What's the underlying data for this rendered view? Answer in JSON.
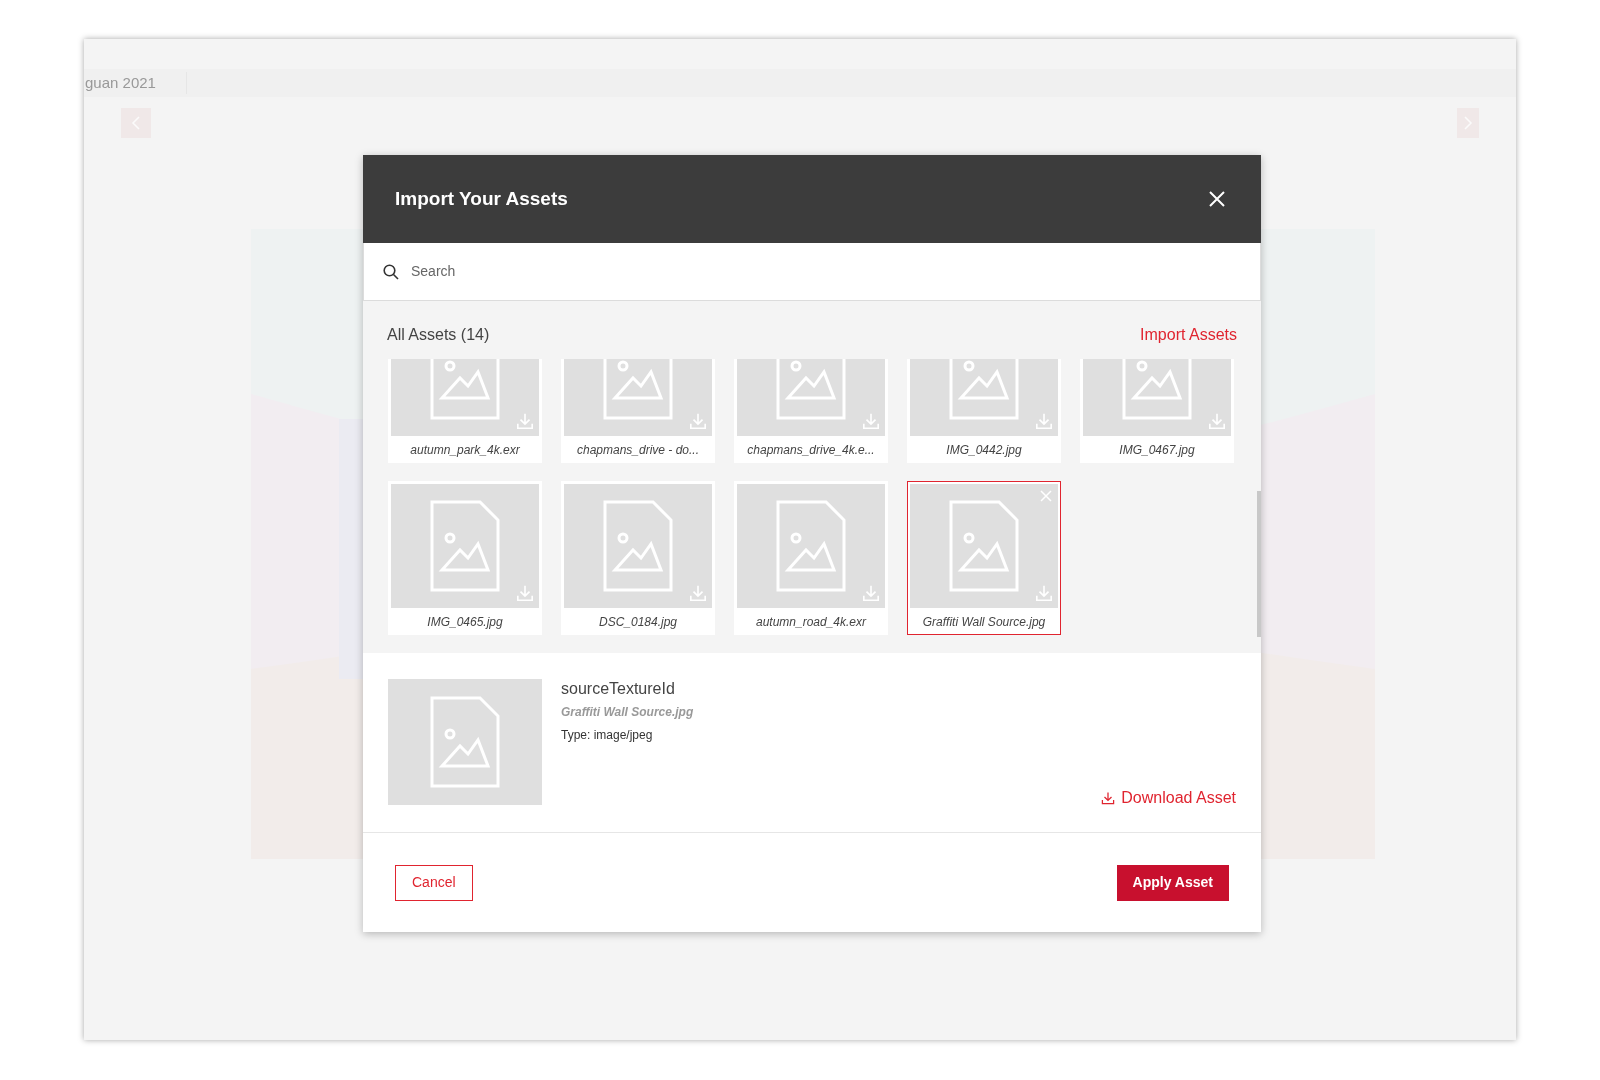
{
  "background": {
    "tab_label": "guan 2021"
  },
  "dialog": {
    "title": "Import Your Assets",
    "search": {
      "placeholder": "Search"
    },
    "section_title": "All Assets (14)",
    "import_link": "Import Assets",
    "assets": [
      {
        "name": "autumn_park_4k.exr",
        "selected": false
      },
      {
        "name": "chapmans_drive - do...",
        "selected": false
      },
      {
        "name": "chapmans_drive_4k.e...",
        "selected": false
      },
      {
        "name": "IMG_0442.jpg",
        "selected": false
      },
      {
        "name": "IMG_0467.jpg",
        "selected": false
      },
      {
        "name": "IMG_0465.jpg",
        "selected": false
      },
      {
        "name": "DSC_0184.jpg",
        "selected": false
      },
      {
        "name": "autumn_road_4k.exr",
        "selected": false
      },
      {
        "name": "Graffiti Wall Source.jpg",
        "selected": true
      }
    ],
    "details": {
      "field": "sourceTextureId",
      "file": "Graffiti Wall Source.jpg",
      "type": "Type: image/jpeg",
      "download": "Download Asset"
    },
    "buttons": {
      "cancel": "Cancel",
      "apply": "Apply Asset"
    }
  }
}
